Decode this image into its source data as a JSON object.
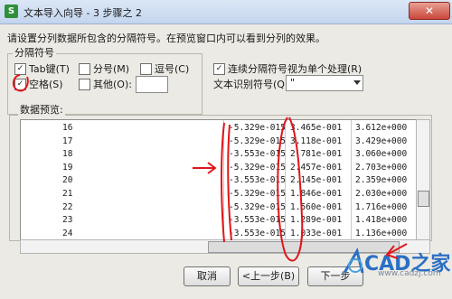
{
  "window": {
    "title": "文本导入向导 - 3 步骤之 2",
    "app_icon_letter": "S",
    "close_label": "✕"
  },
  "instruction": "请设置分列数据所包含的分隔符号。在预览窗口内可以看到分列的效果。",
  "delimiters": {
    "group_label": "分隔符号",
    "tab": {
      "label": "Tab键(T)",
      "checked": true
    },
    "semicolon": {
      "label": "分号(M)",
      "checked": false
    },
    "comma": {
      "label": "逗号(C)",
      "checked": false
    },
    "space": {
      "label": "空格(S)",
      "checked": true
    },
    "other": {
      "label": "其他(O):",
      "checked": false,
      "value": ""
    }
  },
  "consecutive": {
    "label": "连续分隔符号视为单个处理(R)",
    "checked": true
  },
  "text_qualifier": {
    "label": "文本识别符号(Q):",
    "value": "\""
  },
  "preview": {
    "label": "数据预览:",
    "rows": [
      {
        "c1": "16",
        "c2": "-5.329e-015",
        "c3": "3.465e-001",
        "c4": "3.612e+000"
      },
      {
        "c1": "17",
        "c2": "-5.329e-015",
        "c3": "3.118e-001",
        "c4": "3.429e+000"
      },
      {
        "c1": "18",
        "c2": "-3.553e-015",
        "c3": "2.781e-001",
        "c4": "3.060e+000"
      },
      {
        "c1": "19",
        "c2": "-5.329e-015",
        "c3": "2.457e-001",
        "c4": "2.703e+000"
      },
      {
        "c1": "20",
        "c2": "-3.553e-015",
        "c3": "2.145e-001",
        "c4": "2.359e+000"
      },
      {
        "c1": "21",
        "c2": "-5.329e-015",
        "c3": "1.846e-001",
        "c4": "2.030e+000"
      },
      {
        "c1": "22",
        "c2": "-5.329e-015",
        "c3": "1.560e-001",
        "c4": "1.716e+000"
      },
      {
        "c1": "23",
        "c2": "-3.553e-015",
        "c3": "1.289e-001",
        "c4": "1.418e+000"
      },
      {
        "c1": "24",
        "c2": "-3.553e-015",
        "c3": "1.033e-001",
        "c4": "1.136e+000"
      }
    ]
  },
  "buttons": {
    "cancel": "取消",
    "back": "<上一步(B)",
    "next": "下一步"
  },
  "watermark": {
    "text": "CAD之家",
    "sub": "www.cadzj.com"
  },
  "colors": {
    "annotation": "#e0161b",
    "titlebar": "#c3d5ee",
    "dialog_bg": "#eceae4"
  },
  "icons": {
    "app": "spreadsheet-app-icon",
    "close": "close-icon",
    "dropdown": "chevron-down-icon"
  }
}
